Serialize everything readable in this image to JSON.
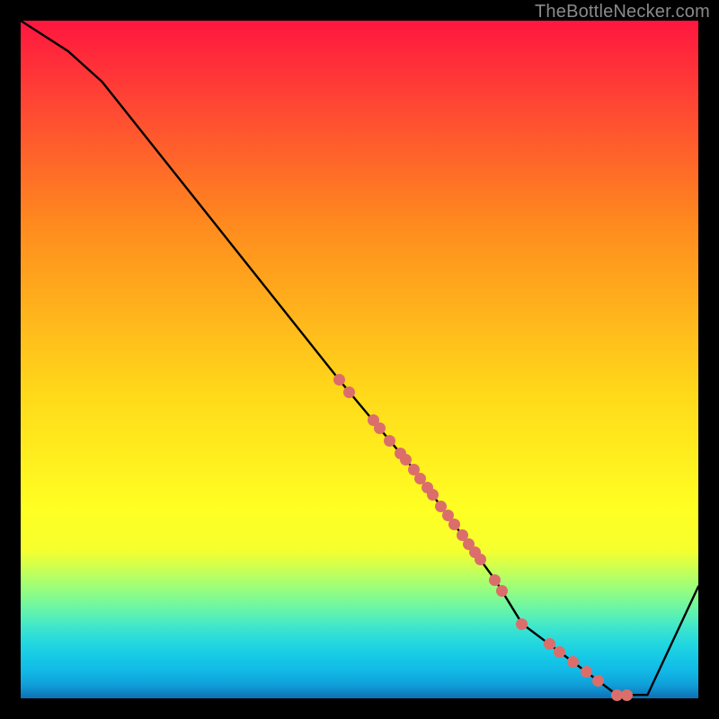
{
  "watermark": {
    "text": "TheBottleNecker.com"
  },
  "chart_data": {
    "type": "line",
    "title": "",
    "xlabel": "",
    "ylabel": "",
    "xlim": [
      0,
      100
    ],
    "ylim": [
      0,
      100
    ],
    "x": [
      0,
      7,
      12,
      47,
      52,
      58,
      70,
      74,
      88,
      92.5,
      100
    ],
    "values": [
      100,
      95.5,
      91,
      47,
      41,
      33.8,
      17.5,
      11,
      0.5,
      0.5,
      16.5
    ],
    "points_on_curve_x": [
      47,
      48.5,
      52,
      53,
      54.5,
      56,
      56.8,
      58,
      59,
      60,
      60.8,
      62,
      63,
      64,
      65.2,
      66.1,
      67,
      67.8,
      70,
      71,
      74,
      78,
      79.5,
      81.5,
      83.5,
      85.2,
      88,
      89.5
    ],
    "colors": {
      "curve": "#000000",
      "dots": "#db6e6b"
    }
  }
}
